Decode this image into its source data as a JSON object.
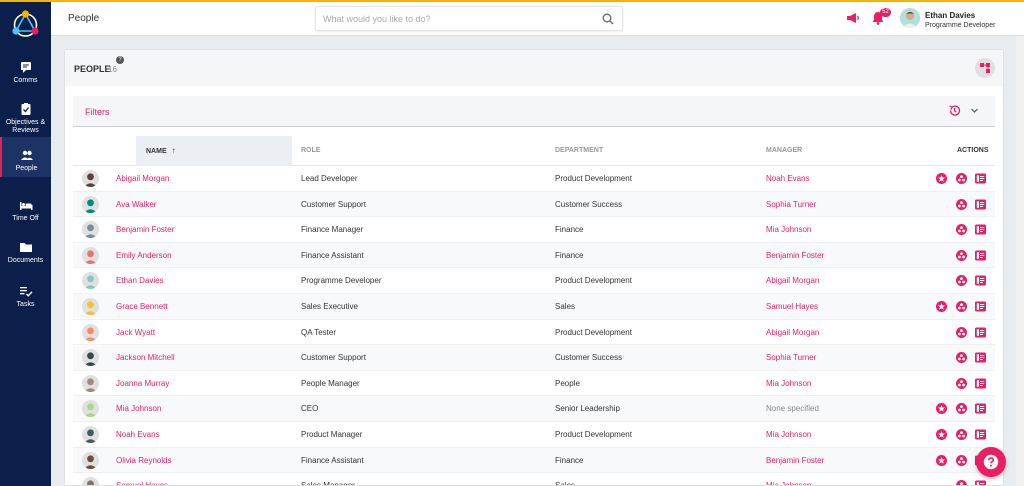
{
  "header": {
    "page_label": "People",
    "search_placeholder": "What would you like to do?",
    "notifications_count": "52",
    "user": {
      "name": "Ethan Davies",
      "role": "Programme Developer"
    }
  },
  "sidebar": {
    "items": [
      {
        "label": "Comms",
        "icon": "comms-icon",
        "active": false
      },
      {
        "label": "Objectives &",
        "label2": "Reviews",
        "icon": "clipboard-check-icon",
        "active": false
      },
      {
        "label": "People",
        "icon": "people-icon",
        "active": true
      },
      {
        "label": "Time Off",
        "icon": "bed-icon",
        "active": false
      },
      {
        "label": "Documents",
        "icon": "folder-icon",
        "active": false
      },
      {
        "label": "Tasks",
        "icon": "tasks-icon",
        "active": false
      }
    ]
  },
  "card": {
    "title": "PEOPLE",
    "count": "16",
    "help": "?"
  },
  "filters": {
    "label": "Filters"
  },
  "table": {
    "columns": {
      "name": "NAME",
      "role": "ROLE",
      "department": "DEPARTMENT",
      "manager": "MANAGER",
      "actions": "ACTIONS"
    },
    "rows": [
      {
        "name": "Abigail Morgan",
        "role": "Lead Developer",
        "department": "Product Development",
        "manager": "Noah Evans",
        "manager_link": true,
        "star": true,
        "avatar_color": "#5d4037"
      },
      {
        "name": "Ava Walker",
        "role": "Customer Support",
        "department": "Customer Success",
        "manager": "Sophia Turner",
        "manager_link": true,
        "star": false,
        "avatar_color": "#00897b"
      },
      {
        "name": "Benjamin Foster",
        "role": "Finance Manager",
        "department": "Finance",
        "manager": "Mia Johnson",
        "manager_link": true,
        "star": false,
        "avatar_color": "#78909c"
      },
      {
        "name": "Emily Anderson",
        "role": "Finance Assistant",
        "department": "Finance",
        "manager": "Benjamin Foster",
        "manager_link": true,
        "star": false,
        "avatar_color": "#e57373"
      },
      {
        "name": "Ethan Davies",
        "role": "Programme Developer",
        "department": "Product Development",
        "manager": "Abigail Morgan",
        "manager_link": true,
        "star": false,
        "avatar_color": "#80cbc4"
      },
      {
        "name": "Grace Bennett",
        "role": "Sales Executive",
        "department": "Sales",
        "manager": "Samuel Hayes",
        "manager_link": true,
        "star": true,
        "avatar_color": "#fbc02d"
      },
      {
        "name": "Jack Wyatt",
        "role": "QA Tester",
        "department": "Product Development",
        "manager": "Abigail Morgan",
        "manager_link": true,
        "star": false,
        "avatar_color": "#ff8a65"
      },
      {
        "name": "Jackson Mitchell",
        "role": "Customer Support",
        "department": "Customer Success",
        "manager": "Sophia Turner",
        "manager_link": true,
        "star": false,
        "avatar_color": "#37474f"
      },
      {
        "name": "Joanna Murray",
        "role": "People Manager",
        "department": "People",
        "manager": "Mia Johnson",
        "manager_link": true,
        "star": false,
        "avatar_color": "#a1887f"
      },
      {
        "name": "Mia Johnson",
        "role": "CEO",
        "department": "Senior Leadership",
        "manager": "None specified",
        "manager_link": false,
        "star": true,
        "avatar_color": "#aed581"
      },
      {
        "name": "Noah Evans",
        "role": "Product Manager",
        "department": "Product Development",
        "manager": "Mia Johnson",
        "manager_link": true,
        "star": true,
        "avatar_color": "#455a64"
      },
      {
        "name": "Olivia Reynolds",
        "role": "Finance Assistant",
        "department": "Finance",
        "manager": "Benjamin Foster",
        "manager_link": true,
        "star": true,
        "avatar_color": "#6d4c41"
      },
      {
        "name": "Samuel Hayes",
        "role": "Sales Manager",
        "department": "Sales",
        "manager": "Mia Johnson",
        "manager_link": true,
        "star": false,
        "avatar_color": "#8d6e63"
      }
    ]
  },
  "colors": {
    "accent": "#e91e63",
    "sidebar": "#0c1f4a",
    "stripe": "#f5b400"
  }
}
